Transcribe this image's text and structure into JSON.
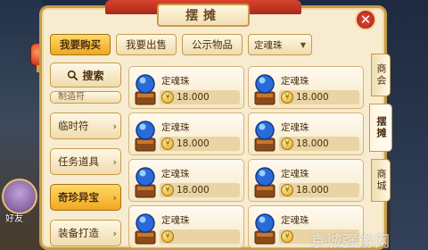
{
  "window": {
    "title": "摆摊"
  },
  "tabs": [
    {
      "label": "我要购买",
      "active": true
    },
    {
      "label": "我要出售",
      "active": false
    },
    {
      "label": "公示物品",
      "active": false
    }
  ],
  "filter": {
    "selected": "定魂珠"
  },
  "search": {
    "label": "搜索"
  },
  "categories": [
    {
      "label": "制造符"
    },
    {
      "label": "临时符"
    },
    {
      "label": "任务道具"
    },
    {
      "label": "奇珍异宝"
    },
    {
      "label": "装备打造"
    }
  ],
  "stalls": [
    {
      "name": "定魂珠",
      "price": "18.000"
    },
    {
      "name": "定魂珠",
      "price": "18.000"
    },
    {
      "name": "定魂珠",
      "price": "18.000"
    },
    {
      "name": "定魂珠",
      "price": "18.000"
    },
    {
      "name": "定魂珠",
      "price": "18.000"
    },
    {
      "name": "定魂珠",
      "price": "18.000"
    },
    {
      "name": "定魂珠",
      "price": ""
    },
    {
      "name": "定魂珠",
      "price": ""
    }
  ],
  "side_tabs": [
    {
      "label": "商会",
      "active": false
    },
    {
      "label": "摆摊",
      "active": true
    },
    {
      "label": "商城",
      "active": false
    }
  ],
  "friend": {
    "label": "好友"
  },
  "watermark": "京城强游网",
  "colors": {
    "accent": "#f0a820",
    "panel": "#f7ecd0",
    "border": "#c79a4a"
  }
}
